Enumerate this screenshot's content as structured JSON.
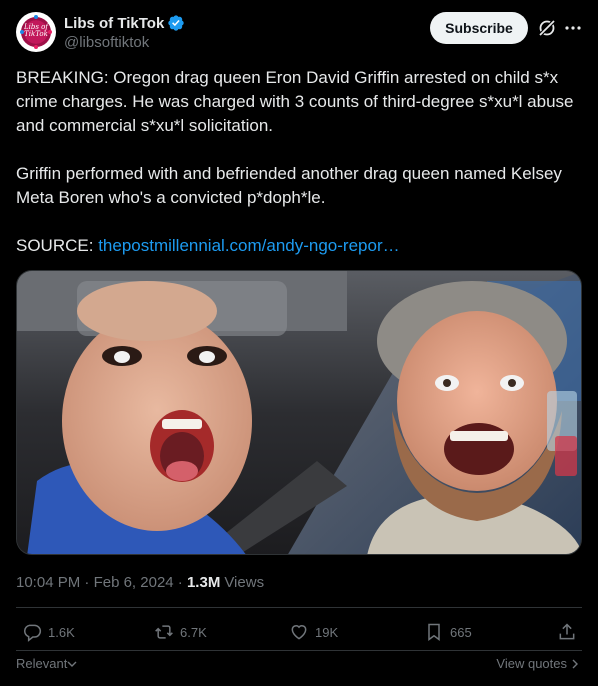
{
  "author": {
    "display_name": "Libs of TikTok",
    "handle": "@libsoftiktok",
    "avatar_text": "Libs of TikTok",
    "verified": true
  },
  "header": {
    "subscribe_label": "Subscribe"
  },
  "tweet": {
    "paragraph_1": "BREAKING: Oregon drag queen Eron David Griffin arrested on child s*x crime charges. He was charged with 3 counts of third-degree s*xu*l abuse and commercial s*xu*l solicitation.",
    "paragraph_2": "Griffin performed with and befriended another drag queen named Kelsey Meta Boren who's a convicted p*doph*le.",
    "source_label": "SOURCE: ",
    "source_link": "thepostmillennial.com/andy-ngo-repor…"
  },
  "meta": {
    "time": "10:04 PM",
    "separator": " · ",
    "date": "Feb 6, 2024",
    "views_count": "1.3M",
    "views_label": "Views"
  },
  "actions": {
    "replies": "1.6K",
    "reposts": "6.7K",
    "likes": "19K",
    "bookmarks": "665"
  },
  "footer": {
    "sort_label": "Relevant",
    "quotes_label": "View quotes"
  },
  "colors": {
    "background": "#000000",
    "text": "#e7e9ea",
    "muted": "#71767b",
    "link": "#1d9bf0",
    "divider": "#2f3336"
  }
}
